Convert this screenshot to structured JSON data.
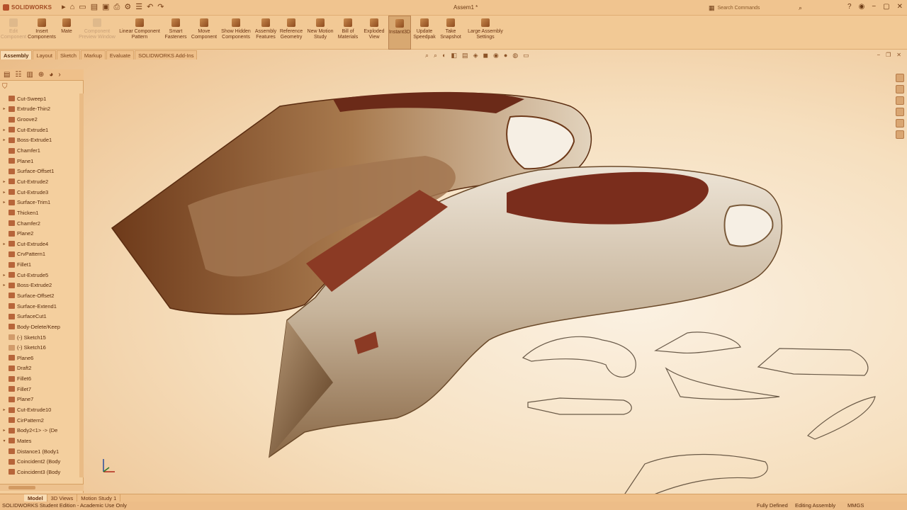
{
  "app": {
    "brand": "SOLIDWORKS",
    "window_title": "Assem1 *"
  },
  "search": {
    "placeholder": "Search Commands"
  },
  "ribbon": [
    {
      "label": "Edit\nComponent",
      "disabled": true
    },
    {
      "label": "Insert\nComponents",
      "disabled": false
    },
    {
      "label": "Mate",
      "disabled": false
    },
    {
      "label": "Component\nPreview Window",
      "disabled": true
    },
    {
      "label": "Linear Component\nPattern",
      "disabled": false
    },
    {
      "label": "Smart\nFasteners",
      "disabled": false
    },
    {
      "label": "Move\nComponent",
      "disabled": false
    },
    {
      "label": "Show Hidden\nComponents",
      "disabled": false
    },
    {
      "label": "Assembly\nFeatures",
      "disabled": false
    },
    {
      "label": "Reference\nGeometry",
      "disabled": false
    },
    {
      "label": "New Motion\nStudy",
      "disabled": false
    },
    {
      "label": "Bill of\nMaterials",
      "disabled": false
    },
    {
      "label": "Exploded\nView",
      "disabled": false
    },
    {
      "label": "Instant3D",
      "disabled": false,
      "active": true
    },
    {
      "label": "Update\nSpeedpak",
      "disabled": false
    },
    {
      "label": "Take\nSnapshot",
      "disabled": false
    },
    {
      "label": "Large Assembly\nSettings",
      "disabled": false
    }
  ],
  "tabs": [
    "Assembly",
    "Layout",
    "Sketch",
    "Markup",
    "Evaluate",
    "SOLIDWORKS Add-Ins"
  ],
  "tree": [
    {
      "label": "Cut-Sweep1",
      "expand": false
    },
    {
      "label": "Extrude-Thin2",
      "expand": true
    },
    {
      "label": "Groove2",
      "expand": false
    },
    {
      "label": "Cut-Extrude1",
      "expand": true
    },
    {
      "label": "Boss-Extrude1",
      "expand": true
    },
    {
      "label": "Chamfer1",
      "expand": false
    },
    {
      "label": "Plane1",
      "expand": false
    },
    {
      "label": "Surface-Offset1",
      "expand": false
    },
    {
      "label": "Cut-Extrude2",
      "expand": true
    },
    {
      "label": "Cut-Extrude3",
      "expand": true
    },
    {
      "label": "Surface-Trim1",
      "expand": true
    },
    {
      "label": "Thicken1",
      "expand": false
    },
    {
      "label": "Chamfer2",
      "expand": false
    },
    {
      "label": "Plane2",
      "expand": false
    },
    {
      "label": "Cut-Extrude4",
      "expand": true
    },
    {
      "label": "CrvPattern1",
      "expand": false
    },
    {
      "label": "Fillet1",
      "expand": false
    },
    {
      "label": "Cut-Extrude5",
      "expand": true
    },
    {
      "label": "Boss-Extrude2",
      "expand": true
    },
    {
      "label": "Surface-Offset2",
      "expand": false
    },
    {
      "label": "Surface-Extend1",
      "expand": false
    },
    {
      "label": "SurfaceCut1",
      "expand": false
    },
    {
      "label": "Body-Delete/Keep",
      "expand": false
    },
    {
      "label": "(-) Sketch15",
      "expand": false,
      "mute": true
    },
    {
      "label": "(-) Sketch16",
      "expand": false,
      "mute": true
    },
    {
      "label": "Plane6",
      "expand": false
    },
    {
      "label": "Draft2",
      "expand": false
    },
    {
      "label": "Fillet6",
      "expand": false
    },
    {
      "label": "Fillet7",
      "expand": false
    },
    {
      "label": "Plane7",
      "expand": false
    },
    {
      "label": "Cut-Extrude10",
      "expand": true
    },
    {
      "label": "CirPattern2",
      "expand": false
    },
    {
      "label": "Body2<1> -> (De",
      "expand": true
    },
    {
      "label": "Mates",
      "expand": true,
      "open": true
    },
    {
      "label": "Distance1 (Body1",
      "expand": false
    },
    {
      "label": "Coincident2 (Body",
      "expand": false
    },
    {
      "label": "Coincident3 (Body",
      "expand": false
    }
  ],
  "bottom_tabs": [
    "Model",
    "3D Views",
    "Motion Study 1"
  ],
  "status": {
    "edition": "SOLIDWORKS Student Edition - Academic Use Only",
    "state": "Fully Defined",
    "mode": "Editing Assembly",
    "units": "MMGS"
  }
}
